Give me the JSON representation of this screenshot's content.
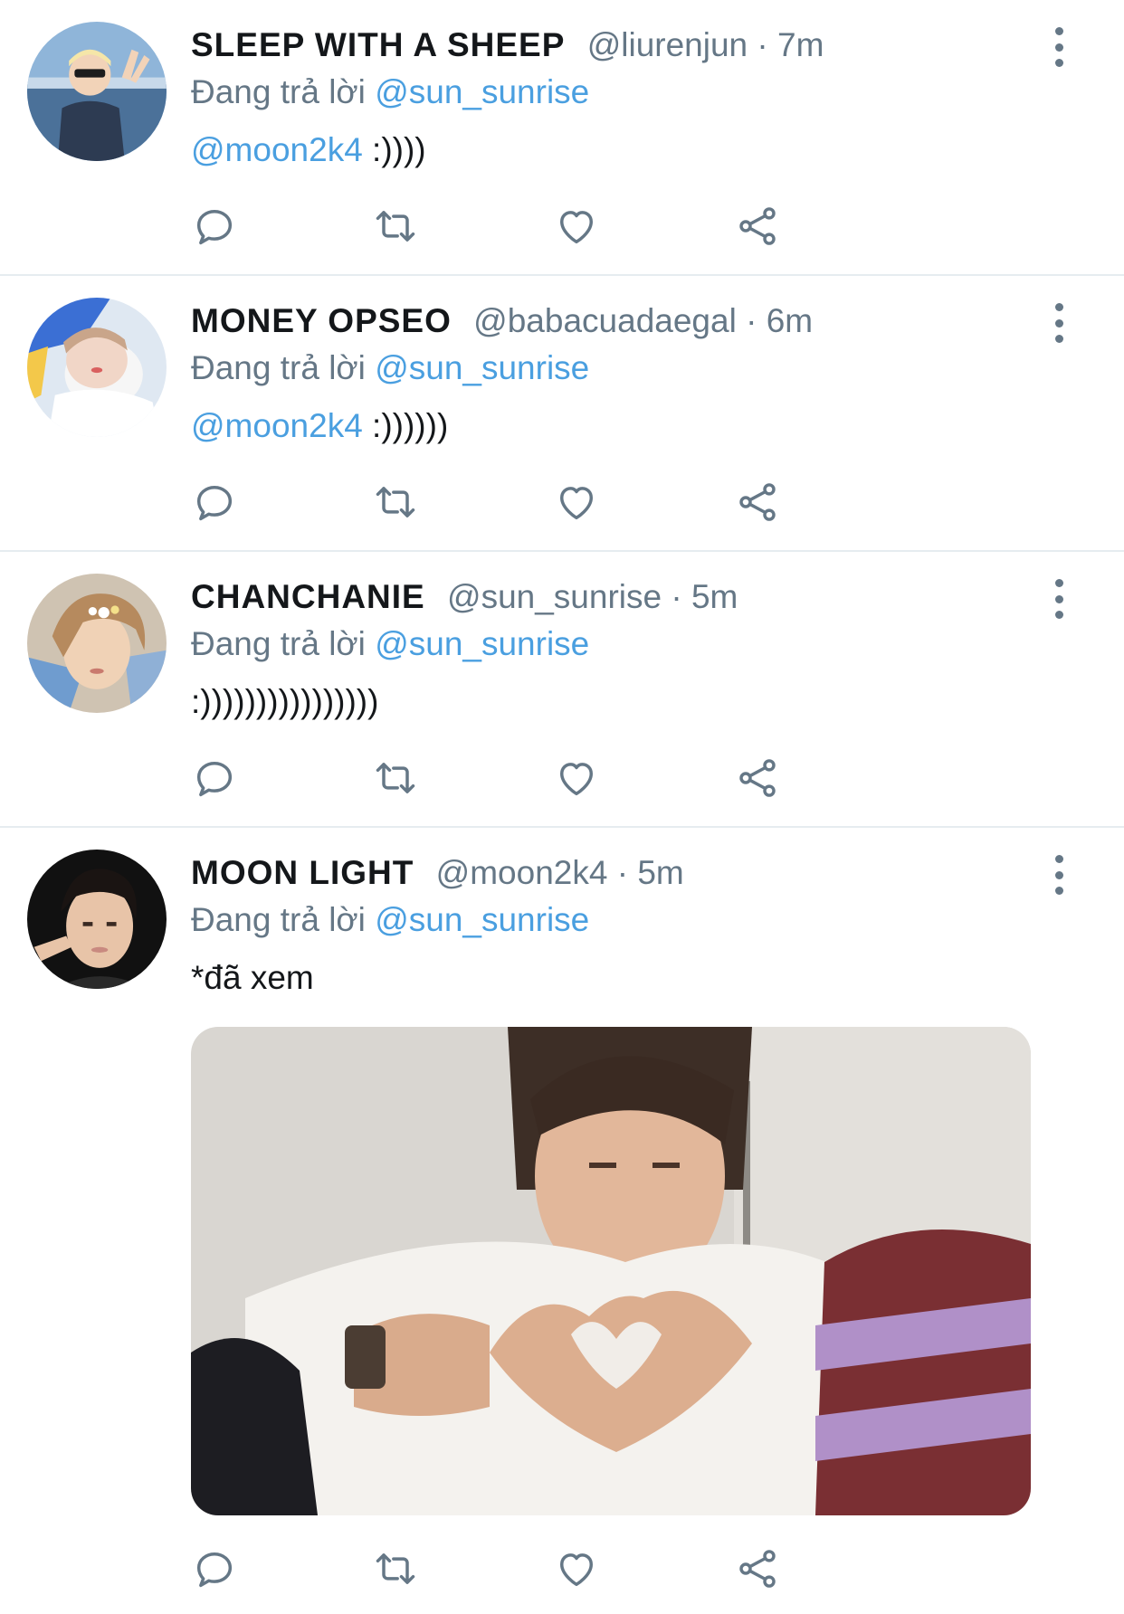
{
  "tweets": [
    {
      "name": "SLEEP WITH A SHEEP",
      "handle": "@liurenjun",
      "separator": "·",
      "time": "7m",
      "reply_prefix": "Đang trả lời",
      "reply_to": "@sun_sunrise",
      "text_mention": "@moon2k4",
      "text": " :))))"
    },
    {
      "name": "MONEY OPSEO",
      "handle": "@babacuadaegal",
      "separator": "·",
      "time": "6m",
      "reply_prefix": "Đang trả lời",
      "reply_to": "@sun_sunrise",
      "text_mention": "@moon2k4",
      "text": " :))))))"
    },
    {
      "name": "CHANCHANIE",
      "handle": "@sun_sunrise",
      "separator": "·",
      "time": "5m",
      "reply_prefix": "Đang trả lời",
      "reply_to": "@sun_sunrise",
      "text_mention": "",
      "text": ":))))))))))))))))"
    },
    {
      "name": "MOON LIGHT",
      "handle": "@moon2k4",
      "separator": "·",
      "time": "5m",
      "reply_prefix": "Đang trả lời",
      "reply_to": "@sun_sunrise",
      "text_mention": "",
      "text": "*đã xem"
    }
  ],
  "icons": {
    "reply": "reply-icon",
    "retweet": "retweet-icon",
    "like": "heart-icon",
    "share": "share-icon",
    "more": "more-vertical-icon"
  },
  "colors": {
    "mention": "#4a9fe0",
    "secondary_text": "#657786",
    "primary_text": "#14171a",
    "divider": "#e6ecf0"
  }
}
